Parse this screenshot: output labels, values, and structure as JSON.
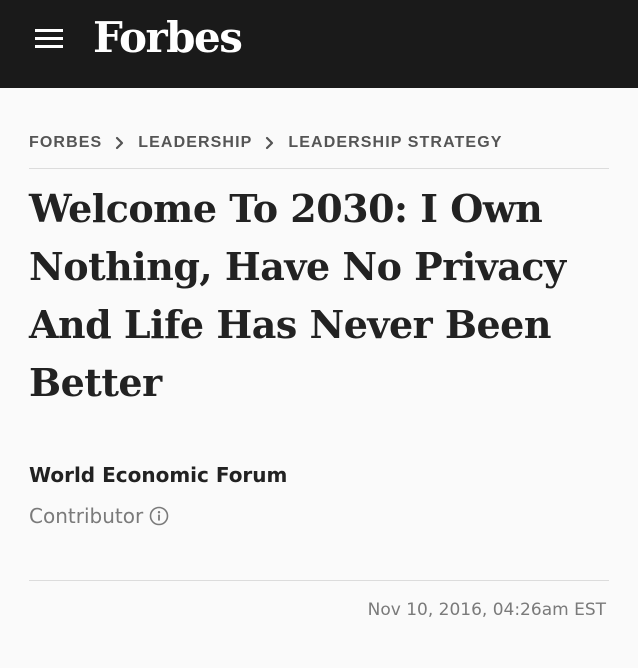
{
  "header": {
    "brand": "Forbes",
    "menu_icon": "hamburger-menu-icon",
    "background": "#1a1a1a"
  },
  "breadcrumb": {
    "items": [
      "FORBES",
      "LEADERSHIP",
      "LEADERSHIP STRATEGY"
    ],
    "separator_icon": "chevron-right-icon"
  },
  "article": {
    "title": "Welcome To 2030: I Own Nothing, Have No Privacy And Life Has Never Been Better",
    "author": "World Economic Forum",
    "role": "Contributor",
    "role_icon": "info-circle-icon",
    "date": "Nov 10, 2016, 04:26am EST"
  }
}
